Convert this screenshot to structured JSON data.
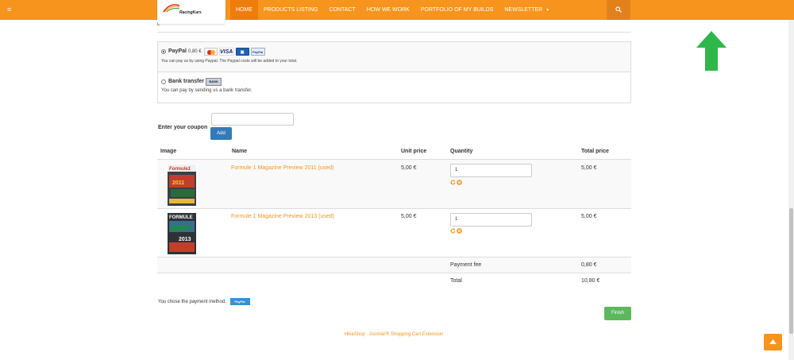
{
  "nav": {
    "menu_icon": "hamburger-icon",
    "logo_text": "RacingKars",
    "items": [
      {
        "label": "HOME",
        "active": true
      },
      {
        "label": "PRODUCTS LISTING"
      },
      {
        "label": "CONTACT"
      },
      {
        "label": "HOW WE WORK"
      },
      {
        "label": "PORTFOLIO OF MY BUILDS"
      },
      {
        "label": "NEWSLETTER",
        "dropdown": true
      }
    ],
    "search_icon": "search-icon"
  },
  "colors": {
    "brand": "#f7941d",
    "primary": "#337ab7",
    "success": "#5cb85c",
    "arrow": "#2eb84b"
  },
  "payment": {
    "paypal": {
      "name": "PayPal",
      "price": "0,80 €",
      "selected": true,
      "cards": [
        "mastercard",
        "visa",
        "amex",
        "paypal"
      ],
      "description": "You can pay us by using Paypal. The Paypal costs will be added to your total."
    },
    "bank": {
      "name": "Bank transfer",
      "badge": "BANK",
      "selected": false,
      "description": "You can pay by sending us a bank transfer."
    }
  },
  "coupon": {
    "label": "Enter your coupon",
    "value": "",
    "button": "Add"
  },
  "cart": {
    "headers": {
      "image": "Image",
      "name": "Name",
      "unit_price": "Unit price",
      "quantity": "Quantity",
      "total_price": "Total price"
    },
    "rows": [
      {
        "name": "Formule 1 Magazine Preview 2011 (used)",
        "unit_price": "5,00 €",
        "quantity": "1",
        "total": "5,00 €",
        "cover_title": "Formule1",
        "cover_year": "2011"
      },
      {
        "name": "Formule 1 Magazine Preview 2013 (used)",
        "unit_price": "5,00 €",
        "quantity": "1",
        "total": "5,00 €",
        "cover_title": "FORMULE",
        "cover_year": "2013"
      }
    ],
    "payment_fee_label": "Payment fee",
    "payment_fee": "0,80 €",
    "total_label": "Total",
    "total": "10,80 €"
  },
  "chosen": {
    "text": "You chose the payment method.",
    "badge": "PayPal"
  },
  "finish": {
    "label": "Finish"
  },
  "footer": {
    "text": "HikaShop . Joomla!® Shopping Cart Extension"
  }
}
